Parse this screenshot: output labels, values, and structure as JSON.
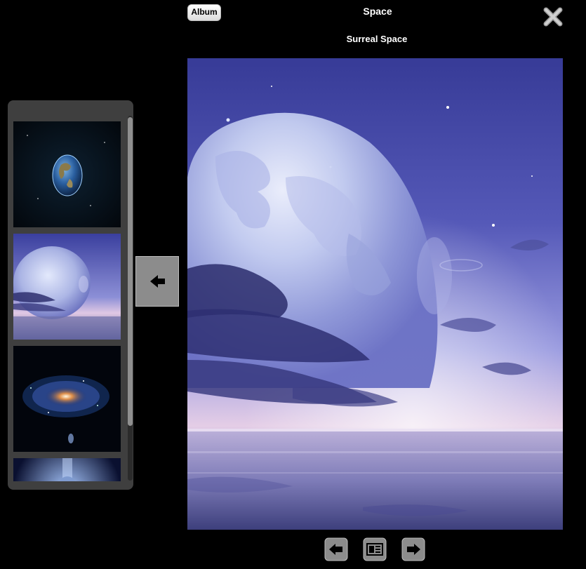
{
  "header": {
    "album_button_label": "Album",
    "album_title": "Space",
    "photo_title": "Surreal Space"
  },
  "thumbnails": [
    {
      "subject": "earth-globe"
    },
    {
      "subject": "surreal-space"
    },
    {
      "subject": "spiral-galaxy"
    },
    {
      "subject": "planet-glow"
    }
  ],
  "selected_thumbnail_index": 1,
  "icons": {
    "close": "close-icon",
    "collapse": "arrow-left-icon",
    "prev": "prev-arrow-icon",
    "slideshow": "slideshow-icon",
    "next": "next-arrow-icon"
  },
  "colors": {
    "background": "#000000",
    "panel": "#3f3f3f",
    "button_gray": "#8c8c8c",
    "sky_top": "#3a3f9e",
    "sky_horizon": "#d6bde0"
  }
}
